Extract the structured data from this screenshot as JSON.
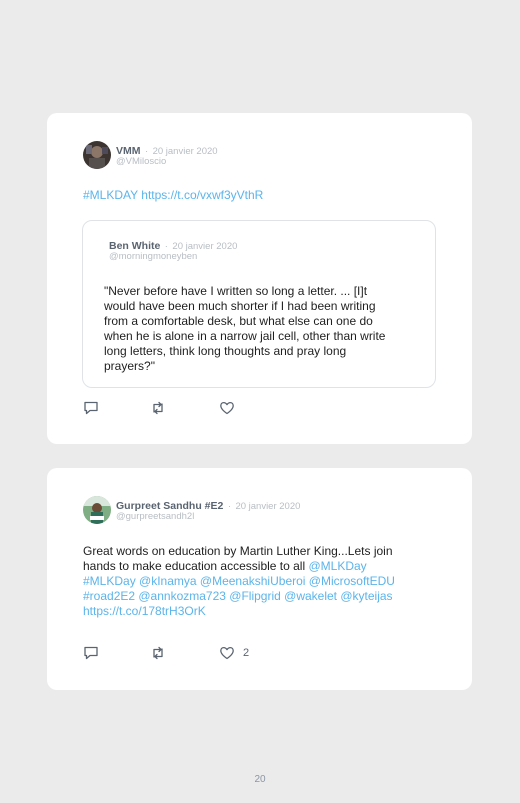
{
  "tweets": [
    {
      "name": "VMM",
      "date": "20 janvier 2020",
      "handle": "@VMiloscio",
      "hashtag": "#MLKDAY",
      "url": "https://t.co/vxwf3yVthR",
      "quoted": {
        "name": "Ben White",
        "date": "20 janvier 2020",
        "handle": "@morningmoneyben",
        "lines": [
          "\"Never before have I written so long a letter. ... [I]t",
          "would have been much shorter if I had been writing",
          "from a comfortable desk, but what else can one do",
          "when he is alone in a narrow jail cell, other than write",
          "long letters, think long thoughts and pray long",
          "prayers?\""
        ]
      },
      "like_count": ""
    },
    {
      "name": "Gurpreet Sandhu #E2",
      "date": "20 janvier 2020",
      "handle": "@gurpreetsandh2l",
      "line1": "Great words on education by Martin Luther King...Lets join",
      "line2_text": "hands to make education accessible to all",
      "line2_link": "@MLKDay",
      "line3": "#MLKDay @kInamya @MeenakshiUberoi @MicrosoftEDU",
      "line4": "#road2E2 @annkozma723 @Flipgrid @wakelet @kyteijas",
      "line5": "https://t.co/178trH3OrK",
      "like_count": "2"
    }
  ],
  "separator": "·",
  "page_number": "20",
  "colors": {
    "link": "#5bb4ea",
    "background": "#ebebeb",
    "card": "#ffffff"
  },
  "icons": [
    "reply-icon",
    "retweet-icon",
    "like-icon"
  ]
}
